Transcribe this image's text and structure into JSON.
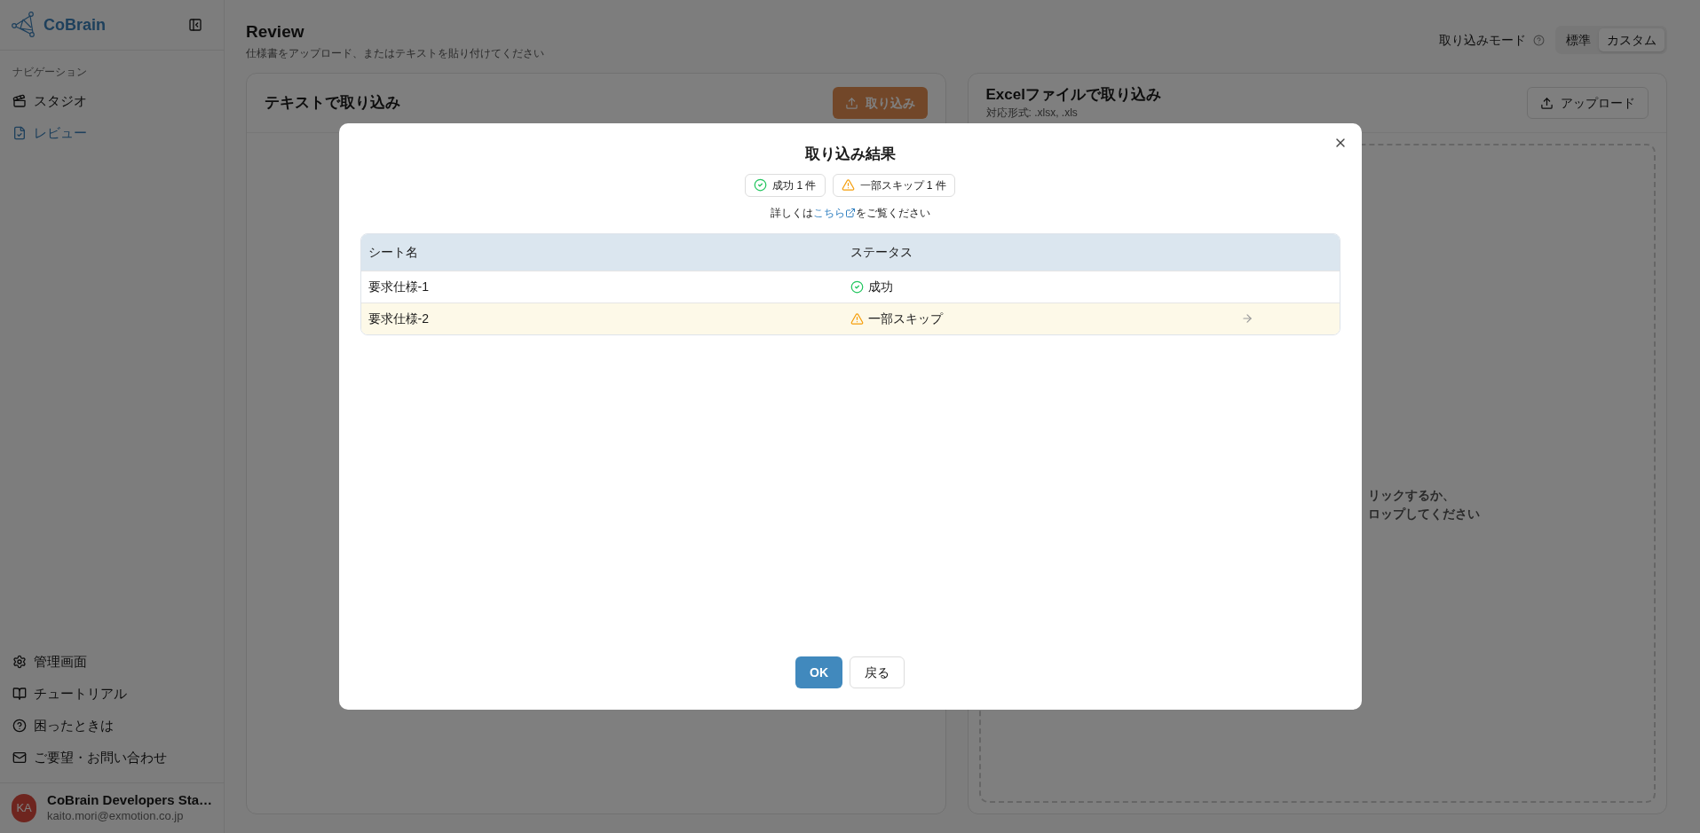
{
  "sidebar": {
    "brand": "CoBrain",
    "section_label": "ナビゲーション",
    "nav_items": [
      {
        "label": "スタジオ",
        "selected": false
      },
      {
        "label": "レビュー",
        "selected": true
      }
    ],
    "footer_items": [
      {
        "label": "管理画面"
      },
      {
        "label": "チュートリアル"
      },
      {
        "label": "困ったときは"
      },
      {
        "label": "ご要望・お問い合わせ"
      }
    ],
    "user": {
      "initials": "KA",
      "name": "CoBrain Developers Sta…",
      "email": "kaito.mori@exmotion.co.jp"
    }
  },
  "page": {
    "title": "Review",
    "subtitle": "仕様書をアップロード、またはテキストを貼り付けてください",
    "mode_label": "取り込みモード",
    "mode_options": [
      {
        "label": "標準",
        "selected": false
      },
      {
        "label": "カスタム",
        "selected": true
      }
    ]
  },
  "text_panel": {
    "title": "テキストで取り込み",
    "button": "取り込み",
    "disabled": true
  },
  "excel_panel": {
    "title": "Excelファイルで取り込み",
    "formats": "対応形式: .xlsx, .xls",
    "button": "アップロード",
    "drop_text": [
      "リックするか、",
      "ロップしてください"
    ]
  },
  "dialog": {
    "title": "取り込み結果",
    "summary": [
      {
        "label": "成功 1 件",
        "kind": "success"
      },
      {
        "label": "一部スキップ 1 件",
        "kind": "warning"
      }
    ],
    "note_before": "詳しくは",
    "link": "こちら",
    "note_after": "をご覧ください",
    "columns": [
      "シート名",
      "ステータス"
    ],
    "rows": [
      {
        "sheet": "要求仕様-1",
        "status": "成功",
        "kind": "success"
      },
      {
        "sheet": "要求仕様-2",
        "status": "一部スキップ",
        "kind": "warning"
      }
    ],
    "buttons": [
      {
        "label": "OK",
        "kind": "primary"
      },
      {
        "label": "戻る",
        "kind": "secondary"
      }
    ]
  }
}
